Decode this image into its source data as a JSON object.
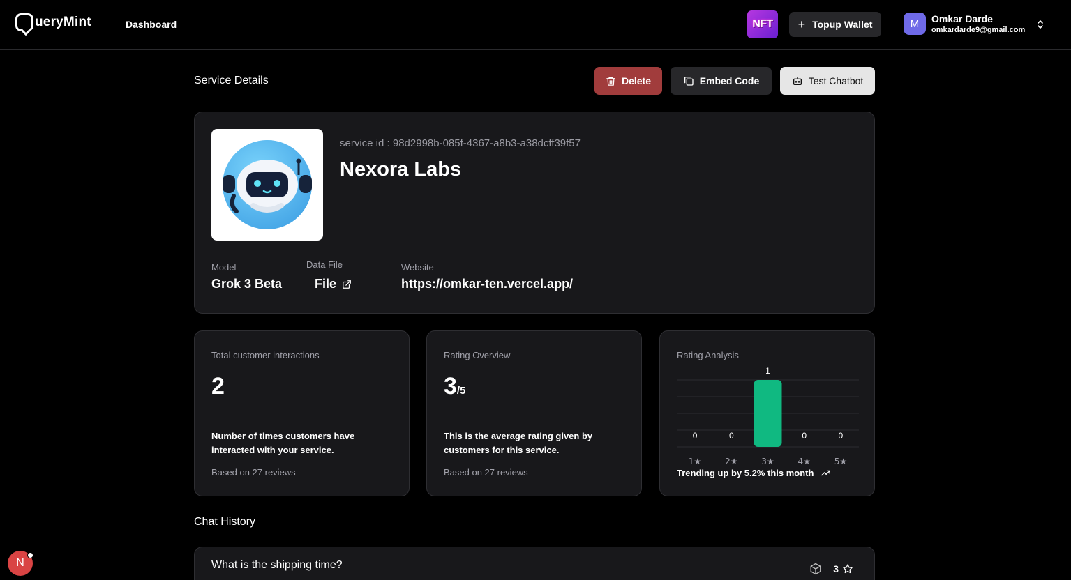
{
  "nav": {
    "brand": "QueryMint",
    "brand_tail": "ueryMint",
    "dashboard": "Dashboard",
    "nft_label": "NFT",
    "topup_label": "Topup Wallet",
    "user_initial": "M",
    "user_name": "Omkar Darde",
    "user_email": "omkardarde9@gmail.com"
  },
  "header": {
    "title": "Service Details",
    "delete_label": "Delete",
    "embed_label": "Embed Code",
    "test_label": "Test Chatbot"
  },
  "service": {
    "id_text": "service id : 98d2998b-085f-4367-a8b3-a38dcff39f57",
    "name": "Nexora Labs",
    "model_label": "Model",
    "model_value": "Grok 3 Beta",
    "data_file_label": "Data File",
    "data_file_value": "File",
    "website_label": "Website",
    "website_value": "https://omkar-ten.vercel.app/"
  },
  "stats": {
    "interactions": {
      "title": "Total customer interactions",
      "value": "2",
      "desc": "Number of times customers have interacted with your service.",
      "foot": "Based on 27 reviews"
    },
    "rating": {
      "title": "Rating Overview",
      "value": "3",
      "suffix": "/5",
      "desc": "This is the average rating given by customers for this service.",
      "foot": "Based on 27 reviews"
    },
    "analysis": {
      "title": "Rating Analysis",
      "trend": "Trending up by 5.2% this month"
    }
  },
  "chart_data": {
    "type": "bar",
    "categories": [
      "1★",
      "2★",
      "3★",
      "4★",
      "5★"
    ],
    "values": [
      0,
      0,
      1,
      0,
      0
    ],
    "ylim": [
      0,
      1
    ],
    "bar_color": "#10b981",
    "grid": true
  },
  "chat": {
    "title": "Chat History",
    "items": [
      {
        "question": "What is the shipping time?",
        "rating": "3"
      }
    ]
  },
  "dev_badge": "N",
  "colors": {
    "background": "#000000",
    "card": "#18181b",
    "delete": "#a13c3c",
    "accent_green": "#10b981"
  }
}
